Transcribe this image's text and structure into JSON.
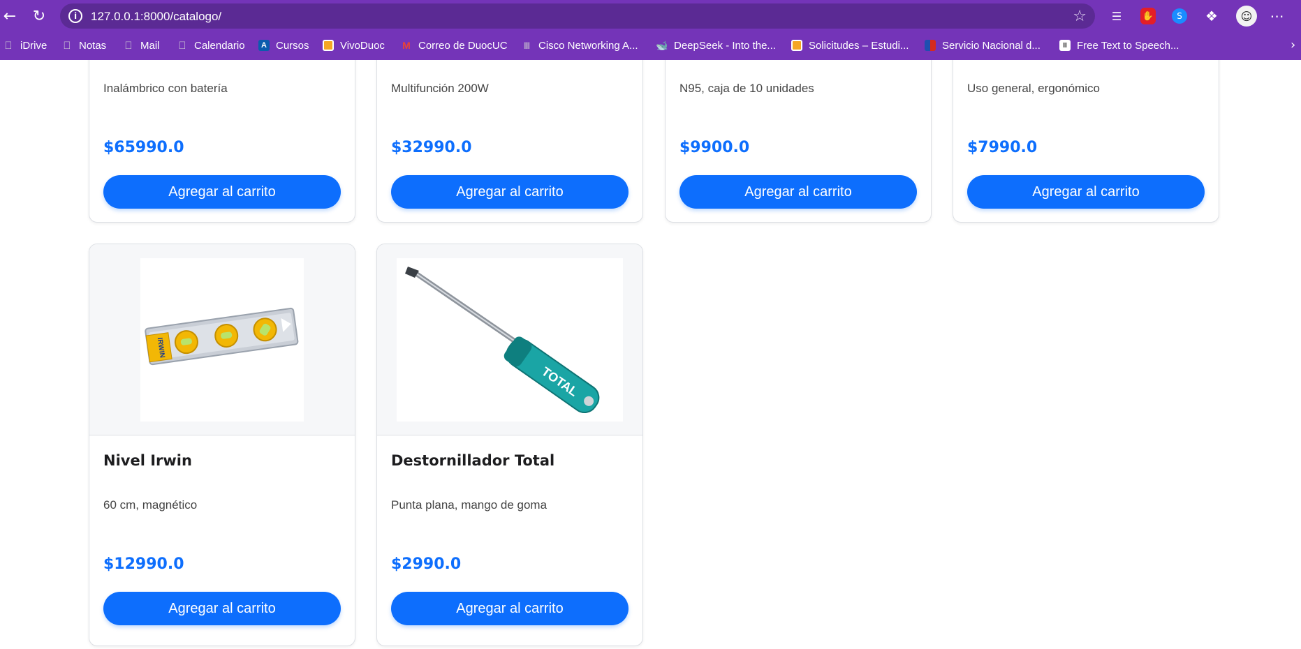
{
  "browser": {
    "url": "127.0.0.1:8000/catalogo/",
    "bookmarks": [
      {
        "label": "iDrive",
        "icon": "apple-icon"
      },
      {
        "label": "Notas",
        "icon": "apple-icon"
      },
      {
        "label": "Mail",
        "icon": "apple-icon"
      },
      {
        "label": "Calendario",
        "icon": "apple-icon"
      },
      {
        "label": "Cursos",
        "icon": "cursos-icon"
      },
      {
        "label": "VivoDuoc",
        "icon": "vivoduoc-icon"
      },
      {
        "label": "Correo de DuocUC",
        "icon": "gmail-icon"
      },
      {
        "label": "Cisco Networking A...",
        "icon": "cisco-icon"
      },
      {
        "label": "DeepSeek - Into the...",
        "icon": "deepseek-icon"
      },
      {
        "label": "Solicitudes – Estudi...",
        "icon": "solicitudes-icon"
      },
      {
        "label": "Servicio Nacional d...",
        "icon": "flag-icon"
      },
      {
        "label": "Free Text to Speech...",
        "icon": "pause-icon"
      }
    ]
  },
  "catalog": {
    "add_label": "Agregar al carrito",
    "products_top": [
      {
        "description": "Inalámbrico con batería",
        "price": "$65990.0"
      },
      {
        "description": "Multifunción 200W",
        "price": "$32990.0"
      },
      {
        "description": "N95, caja de 10 unidades",
        "price": "$9900.0"
      },
      {
        "description": "Uso general, ergonómico",
        "price": "$7990.0"
      }
    ],
    "products_bottom": [
      {
        "name": "Nivel Irwin",
        "description": "60 cm, magnético",
        "price": "$12990.0",
        "image_text": "IRWIN"
      },
      {
        "name": "Destornillador Total",
        "description": "Punta plana, mango de goma",
        "price": "$2990.0",
        "image_text": "TOTAL"
      }
    ]
  },
  "colors": {
    "browser_frame": "#7434b8",
    "address_bar": "#5b2a94",
    "accent_blue": "#0d6efd"
  }
}
